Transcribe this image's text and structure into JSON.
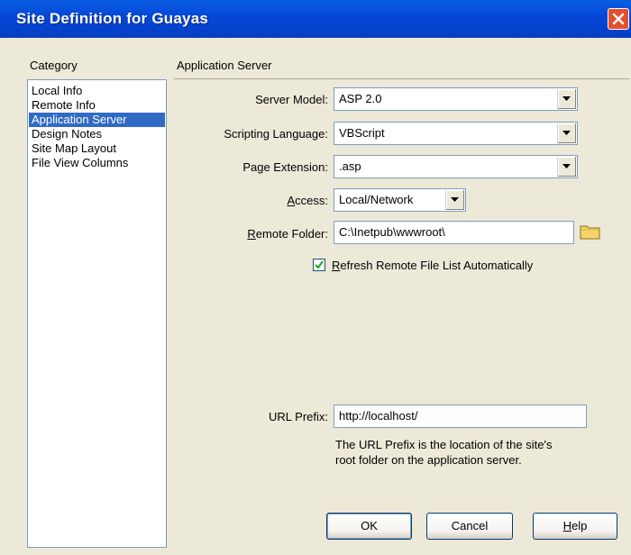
{
  "window": {
    "title": "Site Definition for Guayas"
  },
  "category": {
    "header": "Category",
    "items": [
      "Local Info",
      "Remote Info",
      "Application Server",
      "Design Notes",
      "Site Map Layout",
      "File View Columns"
    ],
    "selected": "Application Server"
  },
  "panel": {
    "title": "Application Server",
    "server_model": {
      "label": "Server Model:",
      "value": "ASP  2.0"
    },
    "scripting_language": {
      "label": "Scripting Language:",
      "value": "VBScript"
    },
    "page_extension": {
      "label": "Page Extension:",
      "value": ".asp"
    },
    "access": {
      "label_prefix": "A",
      "label_rest": "ccess:",
      "value": "Local/Network"
    },
    "remote_folder": {
      "label_prefix": "R",
      "label_rest": "emote Folder:",
      "value": "C:\\Inetpub\\wwwroot\\"
    },
    "refresh": {
      "label_prefix": "R",
      "label_rest": "efresh Remote File List Automatically",
      "checked": true
    },
    "url_prefix": {
      "label": "URL Prefix:",
      "value": "http://localhost/"
    },
    "url_help_line1": "The URL Prefix is the location of the site's",
    "url_help_line2": "root folder on the application server."
  },
  "buttons": {
    "ok": "OK",
    "cancel": "Cancel",
    "help_prefix": "H",
    "help_rest": "elp"
  },
  "colors": {
    "title_bar": "#0546d6",
    "selection": "#316ac5",
    "close": "#e2512d"
  }
}
